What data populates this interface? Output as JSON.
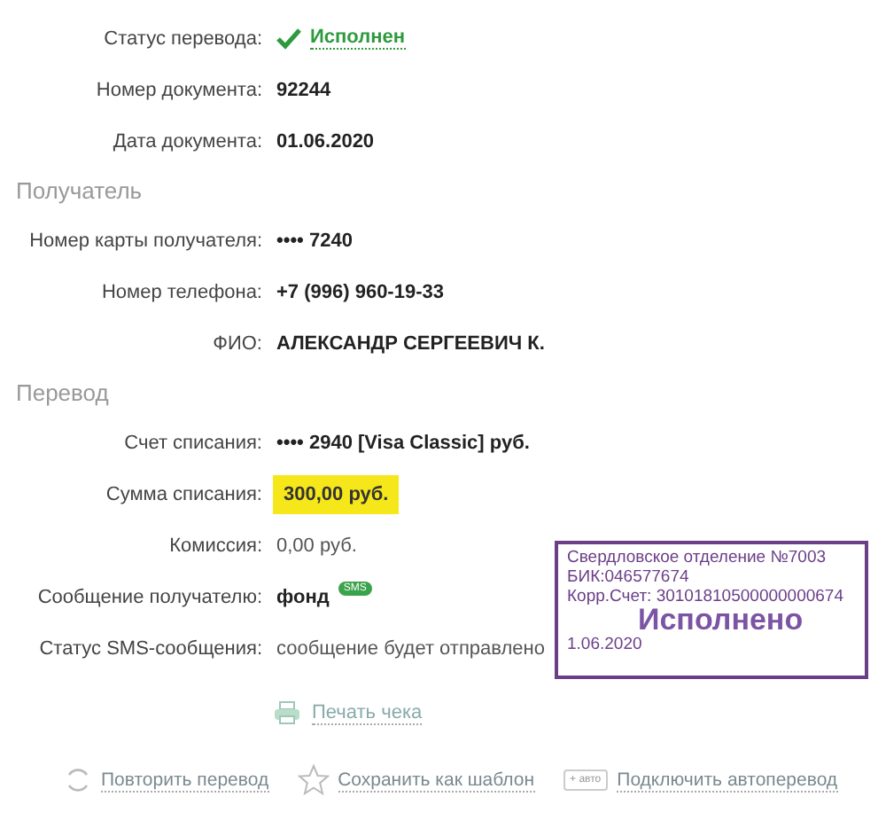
{
  "sections": [
    {
      "rows": [
        {
          "kind": "status",
          "label": "Статус перевода:",
          "value": "Исполнен"
        },
        {
          "kind": "bold",
          "label": "Номер документа:",
          "value": "92244"
        },
        {
          "kind": "bold",
          "label": "Дата документа:",
          "value": "01.06.2020"
        }
      ]
    },
    {
      "title": "Получатель",
      "rows": [
        {
          "kind": "bold",
          "label": "Номер карты получателя:",
          "value": "•••• 7240"
        },
        {
          "kind": "bold",
          "label": "Номер телефона:",
          "value": "+7 (996) 960-19-33"
        },
        {
          "kind": "bold",
          "label": "ФИО:",
          "value": "АЛЕКСАНДР СЕРГЕЕВИЧ К."
        }
      ]
    },
    {
      "title": "Перевод",
      "rows": [
        {
          "kind": "bold",
          "label": "Счет списания:",
          "value": "•••• 2940  [Visa Classic]  руб."
        },
        {
          "kind": "highlight",
          "label": "Сумма списания:",
          "value": "300,00  руб."
        },
        {
          "kind": "plain",
          "label": "Комиссия:",
          "value": "0,00 руб."
        },
        {
          "kind": "sms",
          "label": "Сообщение получателю:",
          "value": "фонд",
          "badge": "SMS"
        },
        {
          "kind": "plain",
          "label": "Статус SMS-сообщения:",
          "value": "сообщение будет отправлено"
        }
      ]
    }
  ],
  "print_link": "Печать чека",
  "actions": [
    {
      "kind": "repeat",
      "label": "Повторить перевод"
    },
    {
      "kind": "star",
      "label": "Сохранить как шаблон"
    },
    {
      "kind": "auto",
      "badge": "+ авто",
      "label": "Подключить автоперевод"
    }
  ],
  "stamp": {
    "lines": [
      "Свердловское отделение №7003",
      "БИК:046577674",
      "Корр.Счет: 30101810500000000674"
    ],
    "status": "Исполнено",
    "date": "1.06.2020"
  }
}
